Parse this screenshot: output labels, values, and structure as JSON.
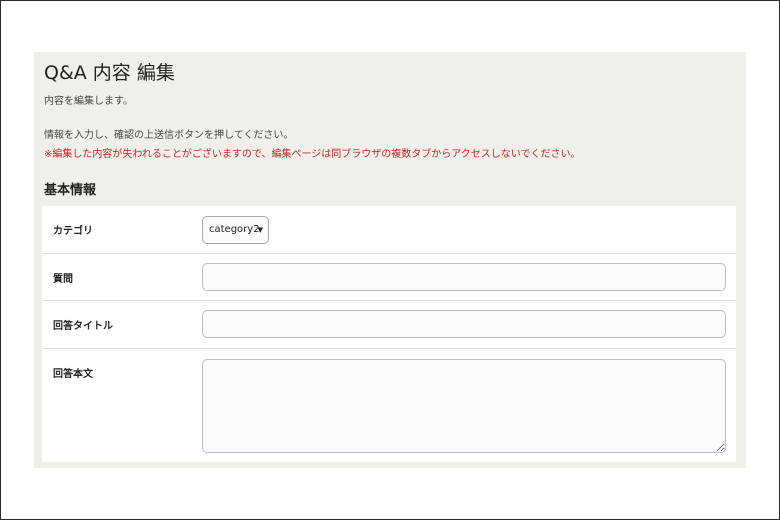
{
  "page": {
    "title": "Q&A 内容 編集",
    "description": "内容を編集します。",
    "instruction": "情報を入力し、確認の上送信ボタンを押してください。",
    "warning": "※編集した内容が失われることがございますので、編集ページは同ブラウザの複数タブからアクセスしないでください。"
  },
  "section": {
    "title": "基本情報"
  },
  "form": {
    "category": {
      "label": "カテゴリ",
      "value": "category2"
    },
    "question": {
      "label": "質問",
      "value": ""
    },
    "answer_title": {
      "label": "回答タイトル",
      "value": ""
    },
    "answer_body": {
      "label": "回答本文",
      "value": ""
    }
  },
  "colors": {
    "panel_bg": "#f0f0ea",
    "warning_text": "#cc2222"
  }
}
